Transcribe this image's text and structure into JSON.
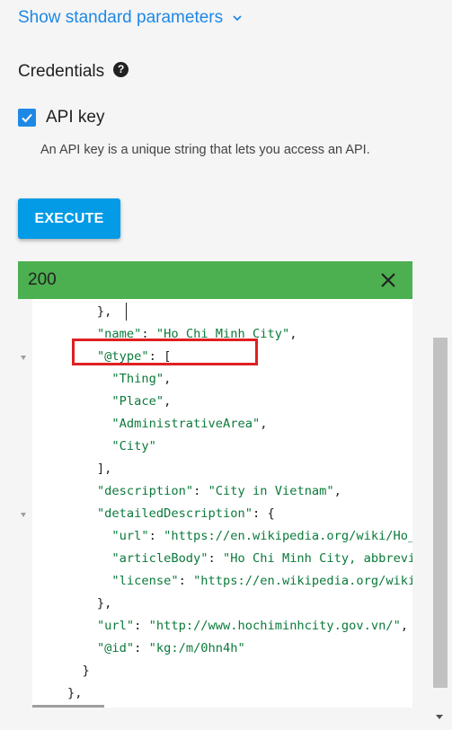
{
  "toggle": {
    "label": "Show standard parameters"
  },
  "credentials": {
    "title": "Credentials",
    "help_glyph": "?",
    "api_key_label": "API key",
    "api_key_checked": true,
    "api_key_description": "An API key is a unique string that lets you access an API."
  },
  "execute_label": "EXECUTE",
  "response": {
    "status": "200",
    "lines": [
      {
        "parts": [
          [
            "p",
            "        },"
          ]
        ]
      },
      {
        "parts": [
          [
            "p",
            "        "
          ],
          [
            "k",
            "\"name\""
          ],
          [
            "p",
            ": "
          ],
          [
            "s",
            "\"Ho Chi Minh City\""
          ],
          [
            "p",
            ","
          ]
        ]
      },
      {
        "parts": [
          [
            "p",
            "        "
          ],
          [
            "k",
            "\"@type\""
          ],
          [
            "p",
            ": ["
          ]
        ],
        "fold": true
      },
      {
        "parts": [
          [
            "p",
            "          "
          ],
          [
            "s",
            "\"Thing\""
          ],
          [
            "p",
            ","
          ]
        ]
      },
      {
        "parts": [
          [
            "p",
            "          "
          ],
          [
            "s",
            "\"Place\""
          ],
          [
            "p",
            ","
          ]
        ]
      },
      {
        "parts": [
          [
            "p",
            "          "
          ],
          [
            "s",
            "\"AdministrativeArea\""
          ],
          [
            "p",
            ","
          ]
        ]
      },
      {
        "parts": [
          [
            "p",
            "          "
          ],
          [
            "s",
            "\"City\""
          ]
        ]
      },
      {
        "parts": [
          [
            "p",
            "        ],"
          ]
        ]
      },
      {
        "parts": [
          [
            "p",
            "        "
          ],
          [
            "k",
            "\"description\""
          ],
          [
            "p",
            ": "
          ],
          [
            "s",
            "\"City in Vietnam\""
          ],
          [
            "p",
            ","
          ]
        ]
      },
      {
        "parts": [
          [
            "p",
            "        "
          ],
          [
            "k",
            "\"detailedDescription\""
          ],
          [
            "p",
            ": {"
          ]
        ],
        "fold": true
      },
      {
        "parts": [
          [
            "p",
            "          "
          ],
          [
            "k",
            "\"url\""
          ],
          [
            "p",
            ": "
          ],
          [
            "s",
            "\"https://en.wikipedia.org/wiki/Ho_"
          ]
        ]
      },
      {
        "parts": [
          [
            "p",
            "          "
          ],
          [
            "k",
            "\"articleBody\""
          ],
          [
            "p",
            ": "
          ],
          [
            "s",
            "\"Ho Chi Minh City, abbrevi"
          ]
        ]
      },
      {
        "parts": [
          [
            "p",
            "          "
          ],
          [
            "k",
            "\"license\""
          ],
          [
            "p",
            ": "
          ],
          [
            "s",
            "\"https://en.wikipedia.org/wiki"
          ]
        ]
      },
      {
        "parts": [
          [
            "p",
            "        },"
          ]
        ]
      },
      {
        "parts": [
          [
            "p",
            "        "
          ],
          [
            "k",
            "\"url\""
          ],
          [
            "p",
            ": "
          ],
          [
            "s",
            "\"http://www.hochiminhcity.gov.vn/\""
          ],
          [
            "p",
            ","
          ]
        ]
      },
      {
        "parts": [
          [
            "p",
            "        "
          ],
          [
            "k",
            "\"@id\""
          ],
          [
            "p",
            ": "
          ],
          [
            "s",
            "\"kg:/m/0hn4h\""
          ]
        ]
      },
      {
        "parts": [
          [
            "p",
            "      }"
          ]
        ]
      },
      {
        "parts": [
          [
            "p",
            "    },"
          ]
        ]
      }
    ]
  },
  "colors": {
    "link": "#1e88e5",
    "execute_bg": "#039be5",
    "success_header": "#4caf50",
    "json_key": "#0b7a3b",
    "highlight_border": "#e02020"
  },
  "icons": {
    "toggle": "chevron-down-icon",
    "help": "help-circle-icon",
    "checkbox": "checkmark-icon",
    "close": "close-icon"
  }
}
